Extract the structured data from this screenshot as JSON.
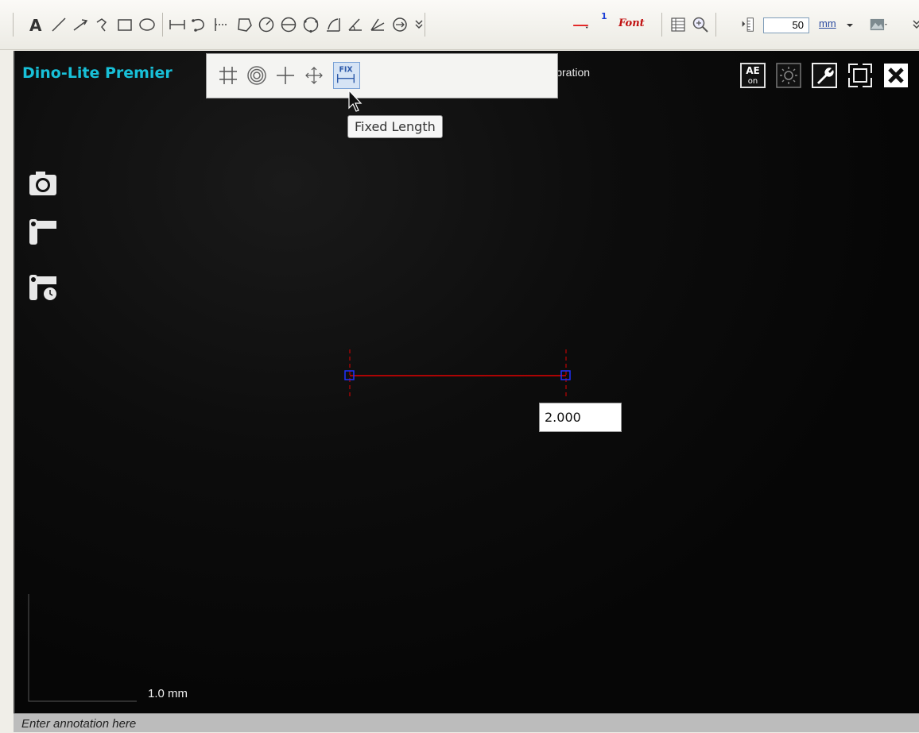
{
  "toolbar": {
    "tools": [
      "text-tool",
      "line-tool",
      "arrow-tool",
      "polyline-tool",
      "rectangle-tool",
      "ellipse-tool",
      "horizontal-length-tool",
      "curve-tool",
      "perpendicular-tool",
      "polygon-tool",
      "circle-center-tool",
      "circle-3point-tool",
      "circle-tool",
      "area-tool",
      "angle-tool",
      "multi-angle-tool",
      "center-circle-distance-tool"
    ],
    "font_label": "Font",
    "line_width_label": "1",
    "magnify_value": "50",
    "unit_label": "mm"
  },
  "viewer": {
    "app_title": "Dino-Lite Premier",
    "calibration_label": "libration",
    "ae_label_top": "AE",
    "ae_label_bottom": "on"
  },
  "popup": {
    "items": [
      "grid",
      "concentric-circles",
      "crosshair",
      "movable-crosshair",
      "fixed-length"
    ],
    "fix_label": "FIX",
    "tooltip": "Fixed Length"
  },
  "measurement": {
    "value": "2.000"
  },
  "scale_bar": {
    "label": "1.0 mm"
  },
  "annotation": {
    "placeholder": "Enter annotation here"
  },
  "colors": {
    "title": "#18c0d8",
    "measure_line": "#e00000",
    "handle": "#2030ff"
  }
}
